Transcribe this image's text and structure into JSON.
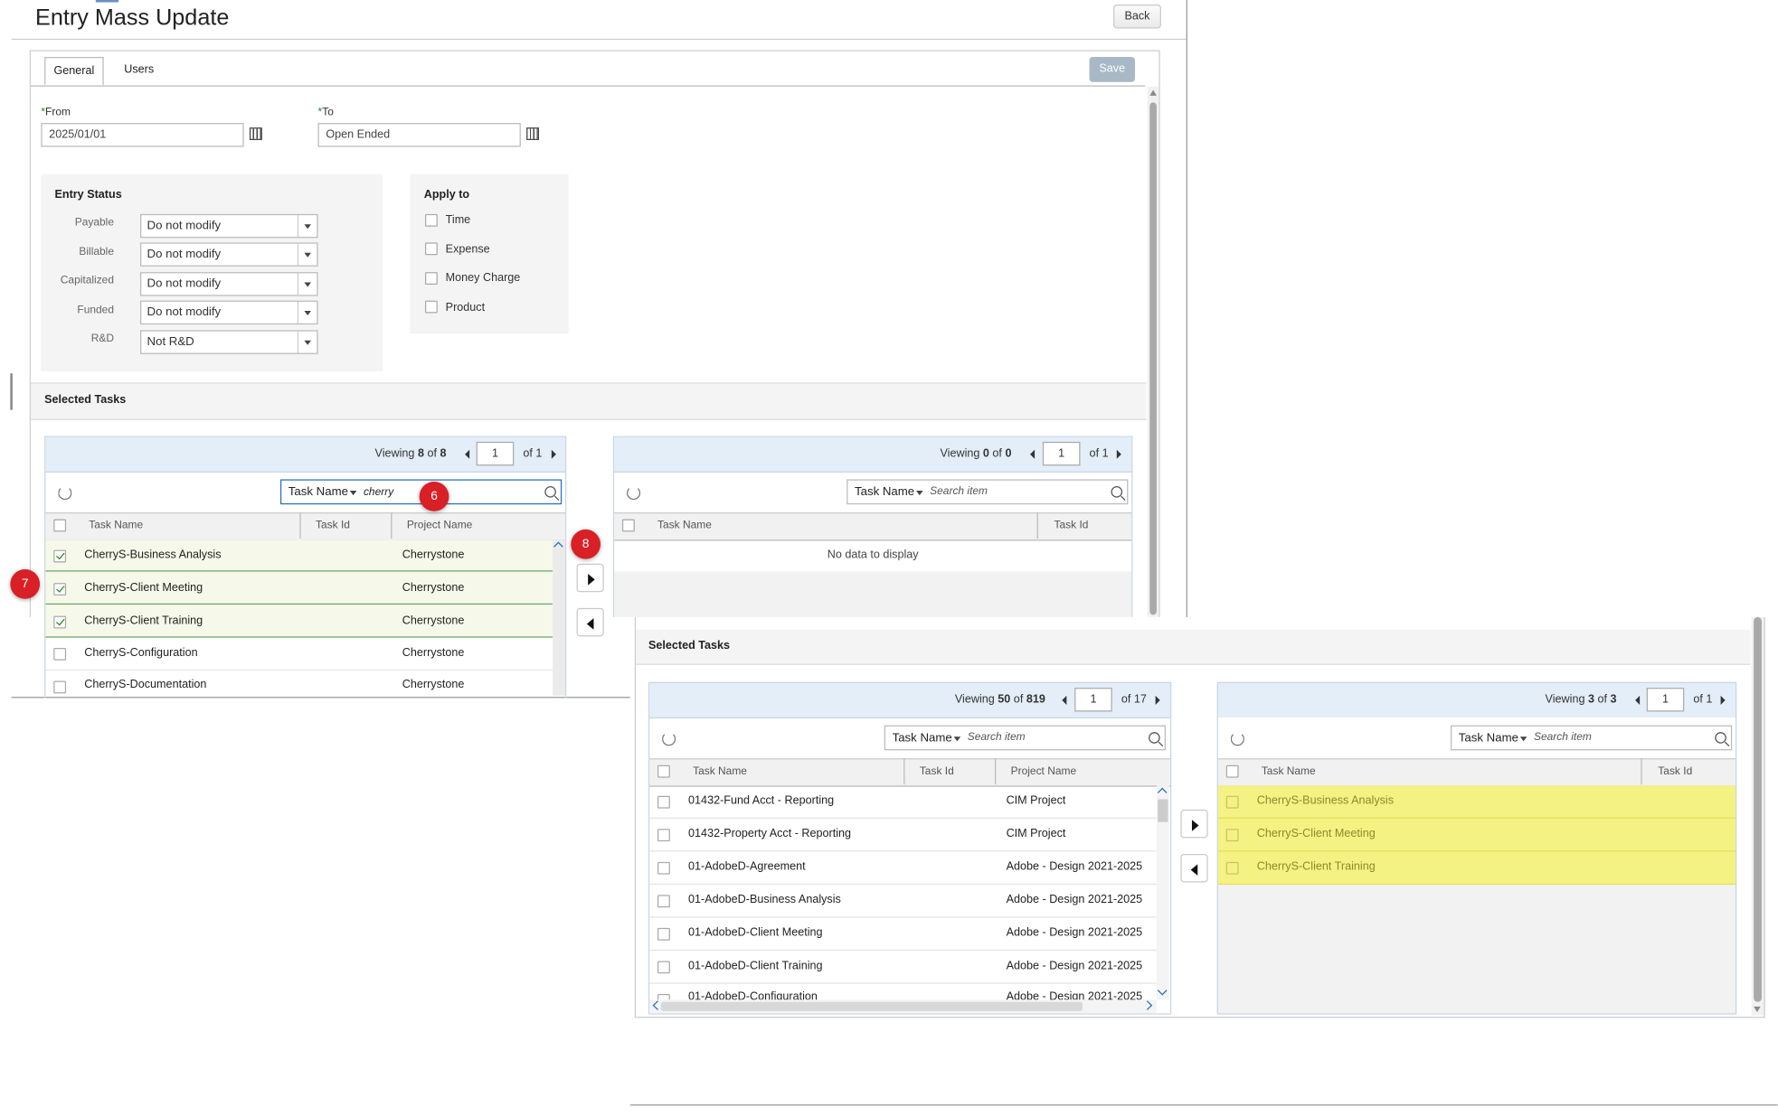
{
  "page": {
    "title": "Entry Mass Update",
    "back_label": "Back"
  },
  "tabs": [
    {
      "label": "General"
    },
    {
      "label": "Users"
    }
  ],
  "save_label": "Save",
  "dates": {
    "required_marker": "*",
    "from_label": "From",
    "from_value": "2025/01/01",
    "to_label": "To",
    "to_value": "Open Ended"
  },
  "entry_status": {
    "title": "Entry Status",
    "rows": [
      {
        "label": "Payable",
        "value": "Do not modify"
      },
      {
        "label": "Billable",
        "value": "Do not modify"
      },
      {
        "label": "Capitalized",
        "value": "Do not modify"
      },
      {
        "label": "Funded",
        "value": "Do not modify"
      },
      {
        "label": "R&D",
        "value": "Not R&D"
      }
    ]
  },
  "apply_to": {
    "title": "Apply to",
    "items": [
      {
        "label": "Time"
      },
      {
        "label": "Expense"
      },
      {
        "label": "Money Charge"
      },
      {
        "label": "Product"
      }
    ]
  },
  "selected_tasks_title": "Selected Tasks",
  "step1": {
    "left": {
      "viewing_label": "Viewing",
      "viewing_count": "8",
      "viewing_of": "of",
      "viewing_total": "8",
      "page": "1",
      "pages_label": "of 1",
      "filter_label": "Task Name",
      "search_value": "cherry",
      "columns": [
        "Task Name",
        "Task Id",
        "Project Name"
      ],
      "rows": [
        {
          "task": "CherryS-Business Analysis",
          "project": "Cherrystone",
          "checked": true
        },
        {
          "task": "CherryS-Client Meeting",
          "project": "Cherrystone",
          "checked": true
        },
        {
          "task": "CherryS-Client Training",
          "project": "Cherrystone",
          "checked": true
        },
        {
          "task": "CherryS-Configuration",
          "project": "Cherrystone",
          "checked": false
        },
        {
          "task": "CherryS-Documentation",
          "project": "Cherrystone",
          "checked": false
        }
      ]
    },
    "right": {
      "viewing_label": "Viewing",
      "viewing_count": "0",
      "viewing_of": "of",
      "viewing_total": "0",
      "page": "1",
      "pages_label": "of 1",
      "filter_label": "Task Name",
      "search_placeholder": "Search item",
      "columns": [
        "Task Name",
        "Task Id"
      ],
      "empty_text": "No data to display"
    },
    "badges": {
      "search": "6",
      "rows": "7",
      "move": "8"
    }
  },
  "step2": {
    "left": {
      "viewing_label": "Viewing",
      "viewing_count": "50",
      "viewing_of": "of",
      "viewing_total": "819",
      "page": "1",
      "pages_label": "of 17",
      "filter_label": "Task Name",
      "search_placeholder": "Search item",
      "columns": [
        "Task Name",
        "Task Id",
        "Project Name"
      ],
      "rows": [
        {
          "task": "01432-Fund Acct - Reporting",
          "project": "CIM Project"
        },
        {
          "task": "01432-Property Acct - Reporting",
          "project": "CIM Project"
        },
        {
          "task": "01-AdobeD-Agreement",
          "project": "Adobe - Design 2021-2025"
        },
        {
          "task": "01-AdobeD-Business Analysis",
          "project": "Adobe - Design 2021-2025"
        },
        {
          "task": "01-AdobeD-Client Meeting",
          "project": "Adobe - Design 2021-2025"
        },
        {
          "task": "01-AdobeD-Client Training",
          "project": "Adobe - Design 2021-2025"
        },
        {
          "task": "01-AdobeD-Configuration",
          "project": "Adobe - Design 2021-2025"
        }
      ]
    },
    "right": {
      "viewing_label": "Viewing",
      "viewing_count": "3",
      "viewing_of": "of",
      "viewing_total": "3",
      "page": "1",
      "pages_label": "of 1",
      "filter_label": "Task Name",
      "search_placeholder": "Search item",
      "columns": [
        "Task Name",
        "Task Id"
      ],
      "rows": [
        {
          "task": "CherryS-Business Analysis"
        },
        {
          "task": "CherryS-Client Meeting"
        },
        {
          "task": "CherryS-Client Training"
        }
      ]
    }
  },
  "colors": {
    "accent_bar": "#e4eef8",
    "selected_row": "#f6f8e9",
    "highlight_row": "#f4f283",
    "badge": "#d92026",
    "save_button": "#a7b8c6"
  }
}
